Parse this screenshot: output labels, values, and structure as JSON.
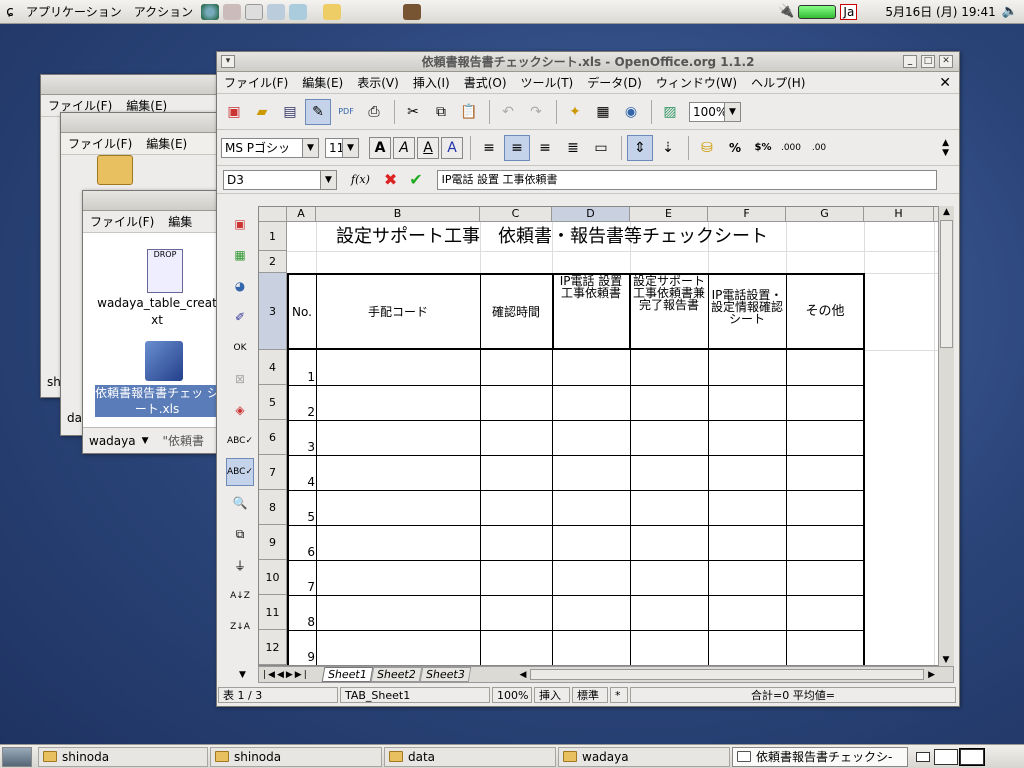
{
  "topbar": {
    "apps": "アプリケーション",
    "actions": "アクション",
    "ime": "Ja",
    "datetime": "5月16日 (月) 19:41"
  },
  "bg_windows": {
    "w1": {
      "menu_file": "ファイル(F)",
      "menu_edit": "編集(E)",
      "status": "sh"
    },
    "w2": {
      "menu_file": "ファイル(F)",
      "menu_edit": "編集(E)",
      "status": "da"
    },
    "w3": {
      "menu_file": "ファイル(F)",
      "menu_edit": "編集",
      "file1": "wadaya_table_creat xt",
      "file2": "依頼書報告書チェッ シート.xls",
      "location": "wadaya",
      "location2": "\"依頼書"
    }
  },
  "calc": {
    "title": "依頼書報告書チェックシート.xls - OpenOffice.org 1.1.2",
    "menu": [
      "ファイル(F)",
      "編集(E)",
      "表示(V)",
      "挿入(I)",
      "書式(O)",
      "ツール(T)",
      "データ(D)",
      "ウィンドウ(W)",
      "ヘルプ(H)"
    ],
    "zoom": "100%",
    "font": "MS Pゴシッ",
    "size": "11",
    "cellref": "D3",
    "fx": "f(x)",
    "formula": "IP電話 設置 工事依頼書",
    "columns": [
      "A",
      "B",
      "C",
      "D",
      "E",
      "F",
      "G",
      "H"
    ],
    "rows": [
      "1",
      "2",
      "3",
      "4",
      "5",
      "6",
      "7",
      "8",
      "9",
      "10",
      "11",
      "12"
    ],
    "a1": "設定サポート工事　依頼書・報告書等チェックシート",
    "headers": {
      "a": "No.",
      "b": "手配コード",
      "c": "確認時間",
      "d": "IP電話 設置 工事依頼書",
      "e": "設定サポート 工事依頼書兼 完了報告書",
      "f": "IP電話設置・設定情報確認シート",
      "g": "その他"
    },
    "numbers": [
      "1",
      "2",
      "3",
      "4",
      "5",
      "6",
      "7",
      "8",
      "9"
    ],
    "sheets": [
      "Sheet1",
      "Sheet2",
      "Sheet3"
    ],
    "status": {
      "sheet": "表 1 / 3",
      "style": "TAB_Sheet1",
      "zoom": "100%",
      "mode": "挿入",
      "sel": "標準",
      "mark": "*",
      "sum": "合計=0 平均値="
    }
  },
  "taskbar": [
    "shinoda",
    "shinoda",
    "data",
    "wadaya",
    "依頼書報告書チェックシ-"
  ]
}
